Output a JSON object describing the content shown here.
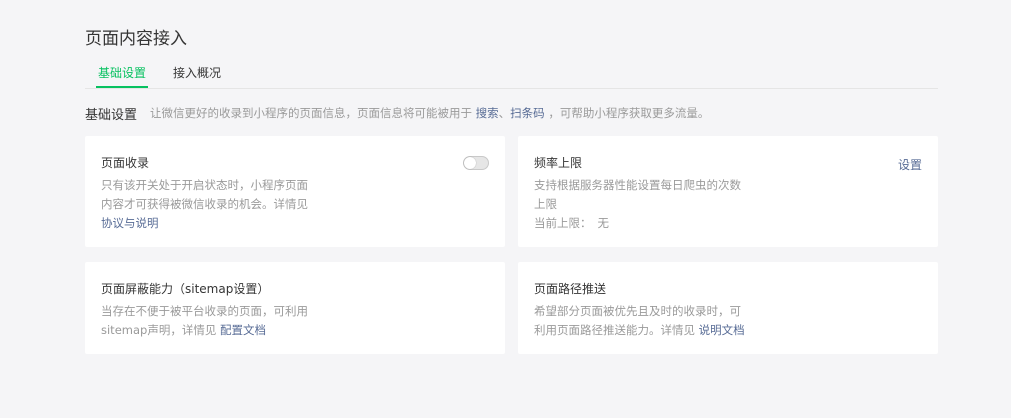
{
  "page": {
    "title": "页面内容接入"
  },
  "tabs": [
    {
      "label": "基础设置",
      "active": true
    },
    {
      "label": "接入概况",
      "active": false
    }
  ],
  "section": {
    "title": "基础设置",
    "desc_prefix": "让微信更好的收录到小程序的页面信息，页面信息将可能被用于",
    "link_search": "搜索",
    "sep": "、",
    "link_scan": "扫条码",
    "desc_suffix": "，可帮助小程序获取更多流量。"
  },
  "cards": {
    "page_indexing": {
      "title": "页面收录",
      "toggle_on": false,
      "desc_line1": "只有该开关处于开启状态时，小程序页面",
      "desc_line2": "内容才可获得被微信收录的机会。详情见",
      "link": "协议与说明"
    },
    "rate_limit": {
      "title": "频率上限",
      "action": "设置",
      "desc_line1": "支持根据服务器性能设置每日爬虫的次数",
      "desc_line2": "上限",
      "current_label": "当前上限：",
      "current_value": "无"
    },
    "page_block": {
      "title": "页面屏蔽能力（sitemap设置）",
      "desc_line1": "当存在不便于被平台收录的页面，可利用",
      "desc_line2_prefix": "sitemap声明，详情见",
      "link": "配置文档"
    },
    "path_push": {
      "title": "页面路径推送",
      "desc_line1": "希望部分页面被优先且及时的收录时，可",
      "desc_line2_prefix": "利用页面路径推送能力。详情见",
      "link": "说明文档"
    }
  },
  "colors": {
    "accent": "#07c160",
    "link": "#576b95",
    "background": "#f5f5f7",
    "card": "#ffffff",
    "muted_text": "#9a9a9a"
  }
}
